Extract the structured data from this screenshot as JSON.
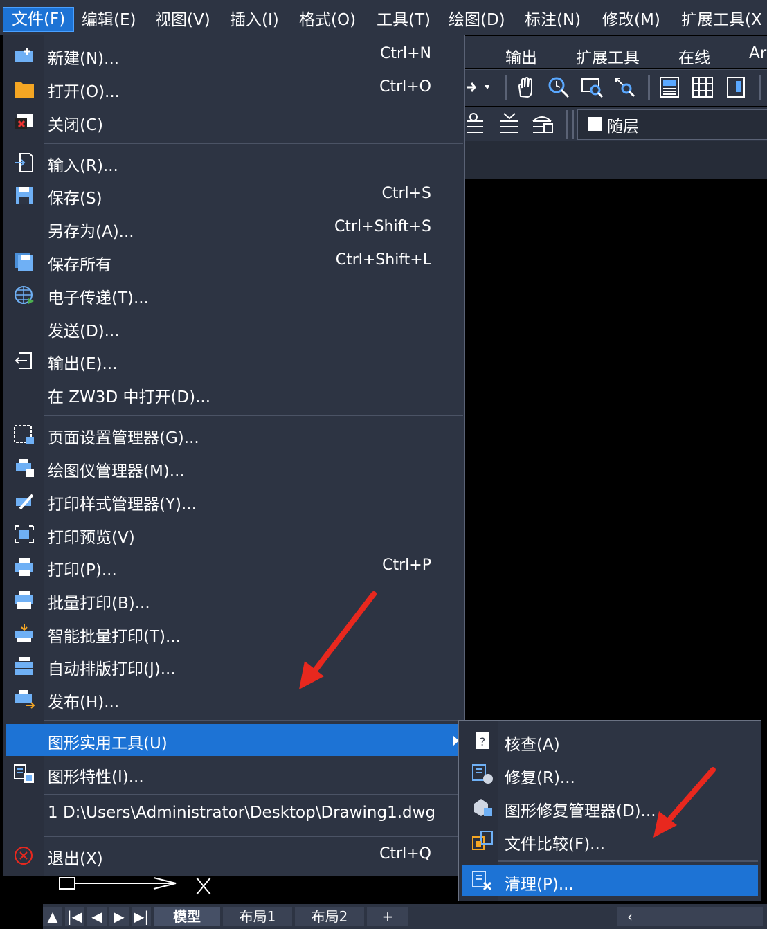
{
  "menubar": {
    "items": [
      "文件(F)",
      "编辑(E)",
      "视图(V)",
      "插入(I)",
      "格式(O)",
      "工具(T)",
      "绘图(D)",
      "标注(N)",
      "修改(M)",
      "扩展工具(X"
    ]
  },
  "ribbon": {
    "tabs": [
      "输出",
      "扩展工具",
      "在线",
      "Ar"
    ]
  },
  "layer": {
    "value": "随层"
  },
  "file_menu": {
    "items": [
      {
        "label": "新建(N)...",
        "shortcut": "Ctrl+N",
        "icon": "new-file-icon"
      },
      {
        "label": "打开(O)...",
        "shortcut": "Ctrl+O",
        "icon": "folder-open-icon"
      },
      {
        "label": "关闭(C)",
        "shortcut": "",
        "icon": "close-file-icon"
      },
      {
        "label": "输入(R)...",
        "shortcut": "",
        "icon": "import-icon"
      },
      {
        "label": "保存(S)",
        "shortcut": "Ctrl+S",
        "icon": "save-icon"
      },
      {
        "label": "另存为(A)...",
        "shortcut": "Ctrl+Shift+S",
        "icon": ""
      },
      {
        "label": "保存所有",
        "shortcut": "Ctrl+Shift+L",
        "icon": "save-all-icon"
      },
      {
        "label": "电子传递(T)...",
        "shortcut": "",
        "icon": "etransmit-globe-icon"
      },
      {
        "label": "发送(D)...",
        "shortcut": "",
        "icon": ""
      },
      {
        "label": "输出(E)...",
        "shortcut": "",
        "icon": "export-icon"
      },
      {
        "label": "在 ZW3D 中打开(D)...",
        "shortcut": "",
        "icon": ""
      },
      {
        "label": "页面设置管理器(G)...",
        "shortcut": "",
        "icon": "page-setup-icon"
      },
      {
        "label": "绘图仪管理器(M)...",
        "shortcut": "",
        "icon": "plotter-manager-icon"
      },
      {
        "label": "打印样式管理器(Y)...",
        "shortcut": "",
        "icon": "plot-style-icon"
      },
      {
        "label": "打印预览(V)",
        "shortcut": "",
        "icon": "print-preview-icon"
      },
      {
        "label": "打印(P)...",
        "shortcut": "Ctrl+P",
        "icon": "printer-icon"
      },
      {
        "label": "批量打印(B)...",
        "shortcut": "",
        "icon": "batch-print-icon"
      },
      {
        "label": "智能批量打印(T)...",
        "shortcut": "",
        "icon": "smart-batch-print-icon"
      },
      {
        "label": "自动排版打印(J)...",
        "shortcut": "",
        "icon": "auto-layout-print-icon"
      },
      {
        "label": "发布(H)...",
        "shortcut": "",
        "icon": "publish-icon"
      },
      {
        "label": "图形实用工具(U)",
        "shortcut": "",
        "icon": ""
      },
      {
        "label": "图形特性(I)...",
        "shortcut": "",
        "icon": "drawing-properties-icon"
      },
      {
        "label": "1  D:\\Users\\Administrator\\Desktop\\Drawing1.dwg",
        "shortcut": "",
        "icon": ""
      },
      {
        "label": "退出(X)",
        "shortcut": "Ctrl+Q",
        "icon": "exit-icon"
      }
    ]
  },
  "submenu": {
    "items": [
      {
        "label": "核查(A)",
        "icon": "audit-icon"
      },
      {
        "label": "修复(R)...",
        "icon": "recover-icon"
      },
      {
        "label": "图形修复管理器(D)...",
        "icon": "recovery-manager-icon"
      },
      {
        "label": "文件比较(F)...",
        "icon": "file-compare-icon"
      },
      {
        "label": "清理(P)...",
        "icon": "purge-icon"
      }
    ]
  },
  "bottom_tabs": [
    "模型",
    "布局1",
    "布局2",
    "+"
  ],
  "colors": {
    "highlight": "#1d73d5",
    "menu_bg": "#2d3443",
    "arrow": "#e8281e"
  }
}
